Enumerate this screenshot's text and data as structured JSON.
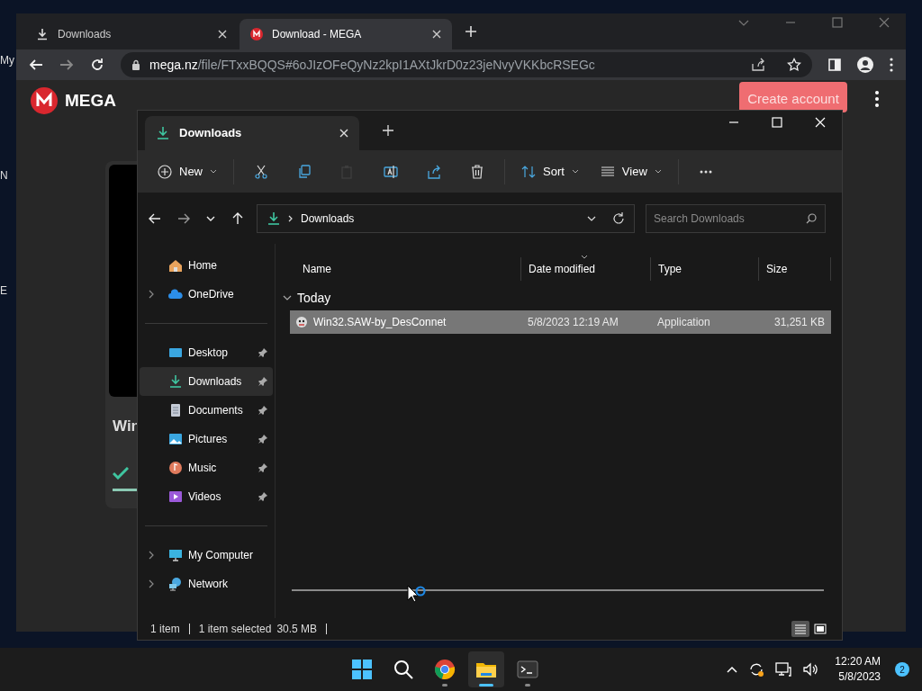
{
  "desktop": {
    "icon_labels": [
      "My",
      "N",
      "E"
    ]
  },
  "browser": {
    "tabs": [
      {
        "label": "Downloads",
        "selected": false,
        "kind": "downloads"
      },
      {
        "label": "Download - MEGA",
        "selected": true,
        "kind": "mega"
      }
    ],
    "address": {
      "domain": "mega.nz",
      "path": "/file/FTxxBQQS#6oJIzOFeQyNz2kpI1AXtJkrD0z23jeNvyVKKbcRSEGc"
    },
    "page": {
      "logo": "MEGA",
      "create_account": "Create account",
      "file_title": "Win",
      "progress": {
        "level": 1
      }
    }
  },
  "explorer": {
    "tab": "Downloads",
    "toolbar": [
      {
        "kind": "new",
        "label": "New",
        "disabled": false
      },
      {
        "kind": "cut",
        "disabled": false
      },
      {
        "kind": "copy",
        "disabled": false
      },
      {
        "kind": "paste",
        "disabled": true
      },
      {
        "kind": "rename",
        "disabled": false
      },
      {
        "kind": "share",
        "disabled": false
      },
      {
        "kind": "delete",
        "disabled": false
      },
      {
        "kind": "sort",
        "label": "Sort",
        "disabled": false
      },
      {
        "kind": "view",
        "label": "View",
        "disabled": false
      },
      {
        "kind": "more",
        "disabled": false
      }
    ],
    "breadcrumb": "Downloads",
    "search": {
      "placeholder": "Search Downloads"
    },
    "nav": [
      [
        {
          "label": "Home",
          "expandable": false,
          "pinned": false,
          "selected": false
        },
        {
          "label": "OneDrive",
          "expandable": true,
          "pinned": false,
          "selected": false
        }
      ],
      [
        {
          "label": "Desktop",
          "expandable": false,
          "pinned": true,
          "selected": false
        },
        {
          "label": "Downloads",
          "expandable": false,
          "pinned": true,
          "selected": true
        },
        {
          "label": "Documents",
          "expandable": false,
          "pinned": true,
          "selected": false
        },
        {
          "label": "Pictures",
          "expandable": false,
          "pinned": true,
          "selected": false
        },
        {
          "label": "Music",
          "expandable": false,
          "pinned": true,
          "selected": false
        },
        {
          "label": "Videos",
          "expandable": false,
          "pinned": true,
          "selected": false
        }
      ],
      [
        {
          "label": "My Computer",
          "expandable": true,
          "pinned": false,
          "selected": false
        },
        {
          "label": "Network",
          "expandable": true,
          "pinned": false,
          "selected": false
        }
      ]
    ],
    "columns": [
      "Name",
      "Date modified",
      "Type",
      "Size"
    ],
    "groups": [
      {
        "label": "Today",
        "expanded": true,
        "rows": [
          {
            "name": "Win32.SAW-by_DesConnet",
            "date": "5/8/2023 12:19 AM",
            "type": "Application",
            "size": "31,251 KB",
            "selected": true
          }
        ]
      }
    ],
    "status": [
      "1 item",
      "1 item selected",
      "30.5 MB"
    ],
    "views": [
      {
        "kind": "details",
        "selected": true
      },
      {
        "kind": "tiles",
        "selected": false
      }
    ]
  },
  "taskbar": {
    "apps": [
      {
        "kind": "start",
        "selected": false
      },
      {
        "kind": "search",
        "selected": false
      },
      {
        "kind": "chrome",
        "selected": false
      },
      {
        "kind": "explorer",
        "selected": true
      },
      {
        "kind": "terminal",
        "selected": false
      }
    ],
    "time": "12:20 AM",
    "date": "5/8/2023",
    "badge": "2"
  }
}
